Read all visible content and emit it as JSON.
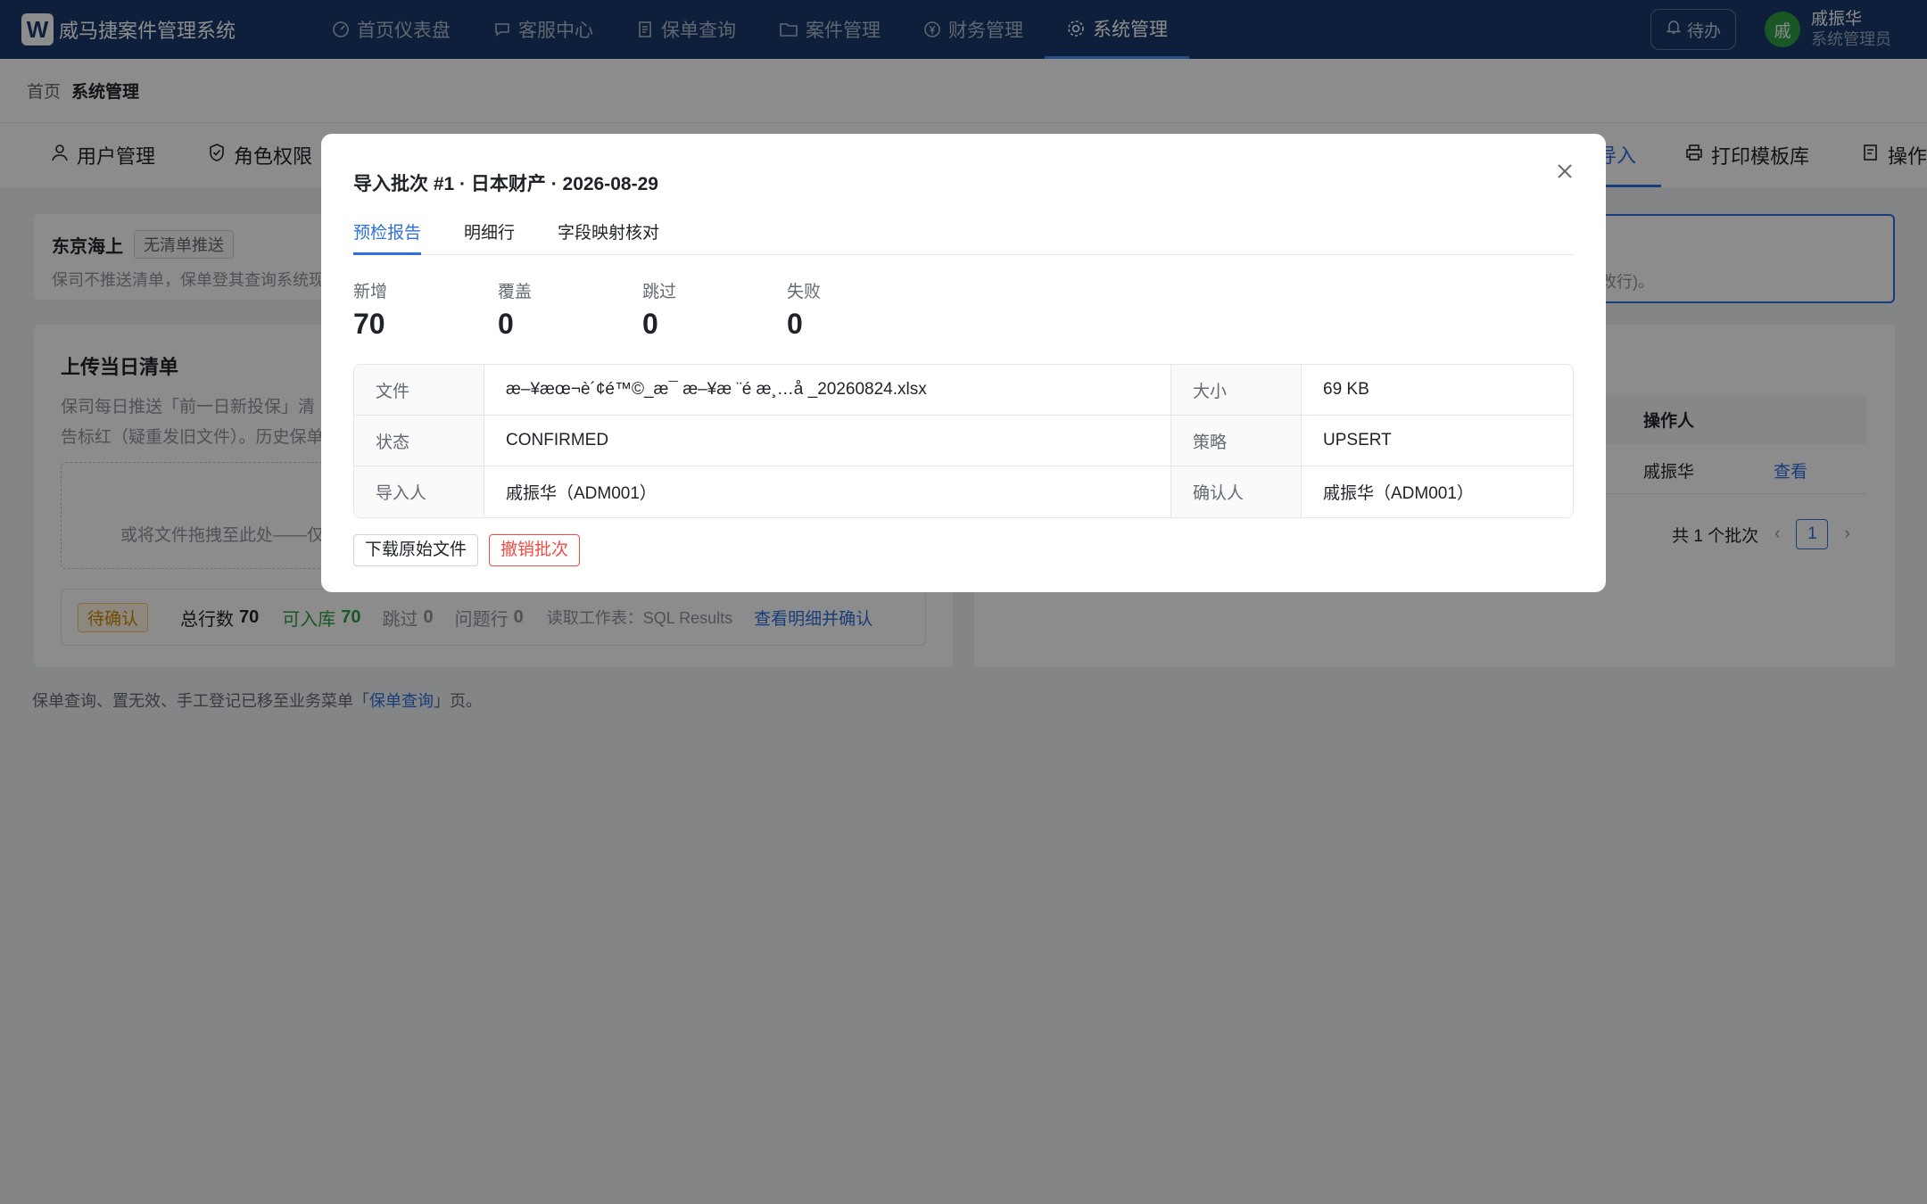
{
  "app": {
    "logo_letter": "W",
    "title": "威马捷案件管理系统"
  },
  "nav": [
    {
      "label": "首页仪表盘",
      "icon": "dashboard-icon"
    },
    {
      "label": "客服中心",
      "icon": "chat-icon"
    },
    {
      "label": "保单查询",
      "icon": "document-icon"
    },
    {
      "label": "案件管理",
      "icon": "folder-icon"
    },
    {
      "label": "财务管理",
      "icon": "yen-icon"
    },
    {
      "label": "系统管理",
      "icon": "gear-icon",
      "active": true
    }
  ],
  "top": {
    "todo": "待办",
    "avatar_char": "戚",
    "user_name": "戚振华",
    "user_role": "系统管理员"
  },
  "breadcrumb": {
    "home": "首页",
    "current": "系统管理"
  },
  "subtabs": {
    "t1": "用户管理",
    "t2": "角色权限",
    "t3": "导入",
    "t4": "打印模板库",
    "t5": "操作"
  },
  "left_notice": {
    "title": "东京海上",
    "tag": "无清单推送",
    "desc": "保司不推送清单，保单登其查询系统现"
  },
  "right_notice": {
    "text": "改行)。"
  },
  "upload": {
    "title": "上传当日清单",
    "desc1": "保司每日推送「前一日新投保」清",
    "desc2": "告标红（疑重发旧文件）。历史保单",
    "drop": "或将文件拖拽至此处——仅",
    "status": "待确认",
    "total_label": "总行数",
    "total_val": "70",
    "ok_label": "可入库",
    "ok_val": "70",
    "skip_label": "跳过",
    "skip_val": "0",
    "issue_label": "问题行",
    "issue_val": "0",
    "sheet": "读取工作表：SQL Results",
    "link": "查看明细并确认"
  },
  "history": {
    "col_operator": "操作人",
    "operator": "戚振华",
    "view": "查看",
    "total": "共 1 个批次",
    "page": "1"
  },
  "footer": {
    "prefix": "保单查询、置无效、手工登记已移至业务菜单「",
    "link": "保单查询",
    "suffix": "」页。"
  },
  "modal": {
    "title": "导入批次 #1 · 日本财产 · 2026-08-29",
    "tabs": [
      "预检报告",
      "明细行",
      "字段映射核对"
    ],
    "stats": [
      {
        "label": "新增",
        "value": "70"
      },
      {
        "label": "覆盖",
        "value": "0"
      },
      {
        "label": "跳过",
        "value": "0"
      },
      {
        "label": "失败",
        "value": "0"
      }
    ],
    "info": [
      {
        "k1": "文件",
        "v1": "æ–¥æœ¬è´¢é™©_æ¯ æ–¥æ ¨é  æ¸…å _20260824.xlsx",
        "k2": "大小",
        "v2": "69 KB"
      },
      {
        "k1": "状态",
        "v1": "CONFIRMED",
        "k2": "策略",
        "v2": "UPSERT"
      },
      {
        "k1": "导入人",
        "v1": "戚振华（ADM001）",
        "k2": "确认人",
        "v2": "戚振华（ADM001）"
      }
    ],
    "download": "下载原始文件",
    "revoke": "撤销批次"
  }
}
